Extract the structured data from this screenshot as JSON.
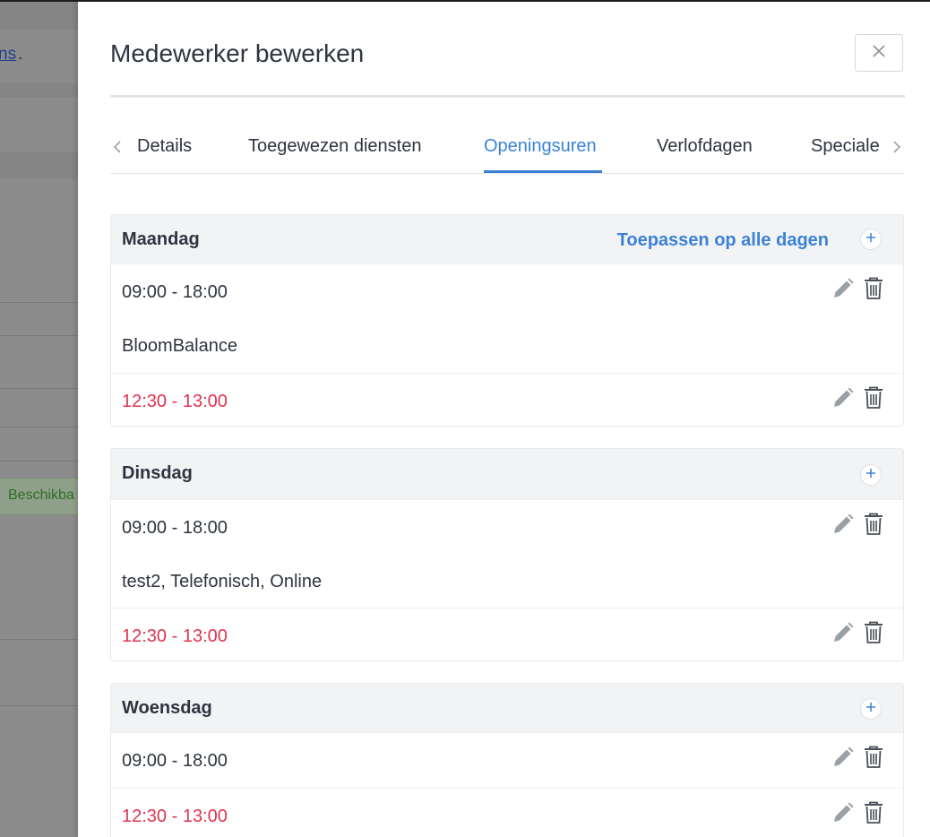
{
  "background": {
    "link_text": "ns",
    "link_suffix": ".",
    "badge_text": "Beschikba"
  },
  "drawer": {
    "title": "Medewerker bewerken",
    "close_icon": "close-icon"
  },
  "tabs": [
    {
      "label": "Details",
      "active": false
    },
    {
      "label": "Toegewezen diensten",
      "active": false
    },
    {
      "label": "Openingsuren",
      "active": true
    },
    {
      "label": "Verlofdagen",
      "active": false
    },
    {
      "label": "Speciale",
      "active": false
    }
  ],
  "days": [
    {
      "name": "Maandag",
      "apply_all_label": "Toepassen op alle dagen",
      "work": {
        "time": "09:00 - 18:00",
        "services": "BloomBalance"
      },
      "break": {
        "time": "12:30 - 13:00"
      }
    },
    {
      "name": "Dinsdag",
      "work": {
        "time": "09:00 - 18:00",
        "services": "test2, Telefonisch, Online"
      },
      "break": {
        "time": "12:30 - 13:00"
      }
    },
    {
      "name": "Woensdag",
      "work": {
        "time": "09:00 - 18:00"
      },
      "break": {
        "time": "12:30 - 13:00"
      }
    }
  ],
  "colors": {
    "accent": "#3b82d6",
    "break_text": "#e0334f",
    "header_bg": "#f2f3f5",
    "text": "#2e3440"
  }
}
